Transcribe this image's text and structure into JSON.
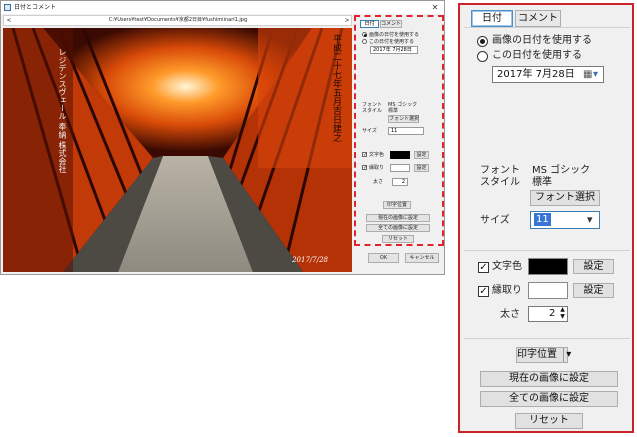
{
  "window": {
    "title": "日付とコメント",
    "close_glyph": "✕",
    "path": "C:¥Users¥test¥Documents¥京都2日目¥fushimiinari1.jpg",
    "prev_glyph": "<",
    "next_glyph": ">"
  },
  "photo": {
    "date_stamp": "2017/7/28",
    "left_plaque": "レジデンスヴェール 奉納 株式会社",
    "right_plaque": "平成二十七年五月吉日建之"
  },
  "panel": {
    "tabs": [
      {
        "label": "日付",
        "selected": true
      },
      {
        "label": "コメント",
        "selected": false
      }
    ],
    "radio_image_date": "画像の日付を使用する",
    "radio_this_date": "この日付を使用する",
    "date_value": "2017年  7月28日",
    "font_label": "フォント",
    "style_label": "スタイル",
    "font_name": "MS ゴシック",
    "font_style": "標準",
    "font_select_button": "フォント選択",
    "size_label": "サイズ",
    "size_value": "11",
    "text_color_label": "文字色",
    "text_color": "#000000",
    "set_button": "設定",
    "outline_label": "縁取り",
    "outline_color": "#ffffff",
    "thickness_label": "太さ",
    "thickness_value": "2",
    "print_position_button": "印字位置",
    "set_current_button": "現在の画像に設定",
    "set_all_button": "全ての画像に設定",
    "reset_button": "リセット",
    "check_mark": "✓",
    "dropdown_glyph": "▾",
    "calendar_glyph": "▦"
  },
  "dialog": {
    "ok_button": "OK",
    "cancel_button": "キャンセル"
  }
}
